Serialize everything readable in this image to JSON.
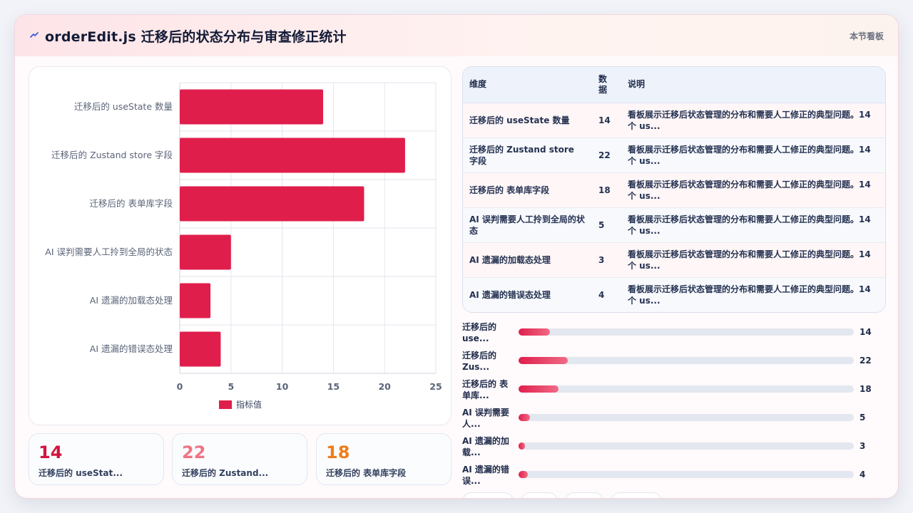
{
  "header": {
    "title": "orderEdit.js 迁移后的状态分布与审查修正统计",
    "corner": "本节看板"
  },
  "chart_data": {
    "type": "bar",
    "orientation": "horizontal",
    "categories": [
      "迁移后的 useState 数量",
      "迁移后的 Zustand store 字段",
      "迁移后的 表单库字段",
      "AI 误判需要人工拎到全局的状态",
      "AI 遗漏的加载态处理",
      "AI 遗漏的错误态处理"
    ],
    "series": [
      {
        "name": "指标值",
        "values": [
          14,
          22,
          18,
          5,
          3,
          4
        ]
      }
    ],
    "xlim": [
      0,
      25
    ],
    "xticks": [
      0,
      5,
      10,
      15,
      20,
      25
    ],
    "grid": true,
    "legend": "bottom",
    "color": "#e01e4b"
  },
  "table": {
    "headers": [
      "维度",
      "数据",
      "说明"
    ],
    "rows": [
      [
        "迁移后的 useState 数量",
        "14",
        "看板展示迁移后状态管理的分布和需要人工修正的典型问题。14 个 us..."
      ],
      [
        "迁移后的 Zustand store 字段",
        "22",
        "看板展示迁移后状态管理的分布和需要人工修正的典型问题。14 个 us..."
      ],
      [
        "迁移后的 表单库字段",
        "18",
        "看板展示迁移后状态管理的分布和需要人工修正的典型问题。14 个 us..."
      ],
      [
        "AI 误判需要人工拎到全局的状态",
        "5",
        "看板展示迁移后状态管理的分布和需要人工修正的典型问题。14 个 us..."
      ],
      [
        "AI 遗漏的加载态处理",
        "3",
        "看板展示迁移后状态管理的分布和需要人工修正的典型问题。14 个 us..."
      ],
      [
        "AI 遗漏的错误态处理",
        "4",
        "看板展示迁移后状态管理的分布和需要人工修正的典型问题。14 个 us..."
      ]
    ]
  },
  "progress": {
    "max": 150,
    "items": [
      {
        "label": "迁移后的 use...",
        "value": "14"
      },
      {
        "label": "迁移后的 Zus...",
        "value": "22"
      },
      {
        "label": "迁移后的 表单库...",
        "value": "18"
      },
      {
        "label": "AI 误判需要人...",
        "value": "5"
      },
      {
        "label": "AI 遗漏的加载...",
        "value": "3"
      },
      {
        "label": "AI 遗漏的错误...",
        "value": "4"
      }
    ]
  },
  "stats": [
    {
      "value": "14",
      "label": "迁移后的 useStat...",
      "color": "#d3143f"
    },
    {
      "value": "22",
      "label": "迁移后的 Zustand...",
      "color": "#f07485"
    },
    {
      "value": "18",
      "label": "迁移后的 表单库字段",
      "color": "#f07d1a"
    }
  ]
}
